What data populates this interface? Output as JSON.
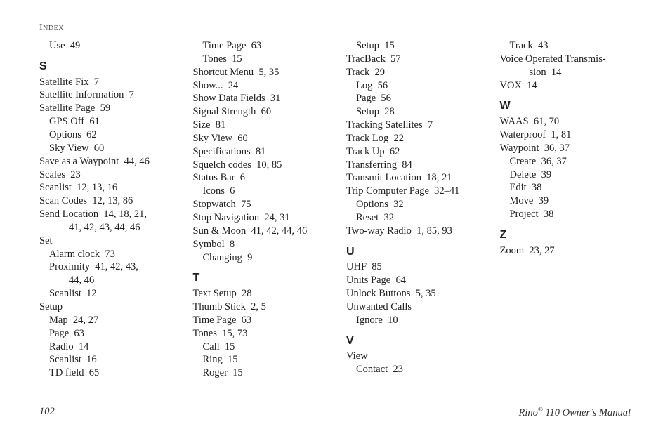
{
  "running_head": "Index",
  "footer": {
    "page_number": "102",
    "manual_title_prefix": "Rino",
    "manual_title_suffix": " 110 Owner’s Manual",
    "reg_mark": "®"
  },
  "columns": [
    [
      {
        "type": "entry",
        "level": 1,
        "text": "Use",
        "pages": "49"
      },
      {
        "type": "letter",
        "text": "S"
      },
      {
        "type": "entry",
        "level": 0,
        "text": "Satellite Fix",
        "pages": "7"
      },
      {
        "type": "entry",
        "level": 0,
        "text": "Satellite Information",
        "pages": "7"
      },
      {
        "type": "entry",
        "level": 0,
        "text": "Satellite Page",
        "pages": "59"
      },
      {
        "type": "entry",
        "level": 1,
        "text": "GPS Off",
        "pages": "61"
      },
      {
        "type": "entry",
        "level": 1,
        "text": "Options",
        "pages": "62"
      },
      {
        "type": "entry",
        "level": 1,
        "text": "Sky View",
        "pages": "60"
      },
      {
        "type": "entry",
        "level": 0,
        "text": "Save as a Waypoint",
        "pages": "44, 46"
      },
      {
        "type": "entry",
        "level": 0,
        "text": "Scales",
        "pages": "23"
      },
      {
        "type": "entry",
        "level": 0,
        "text": "Scanlist",
        "pages": "12, 13, 16"
      },
      {
        "type": "entry",
        "level": 0,
        "text": "Scan Codes",
        "pages": "12, 13, 86"
      },
      {
        "type": "entry",
        "level": 0,
        "text": "Send Location",
        "pages": "14, 18, 21,"
      },
      {
        "type": "entry",
        "level": 2,
        "text": "41, 42, 43, 44, 46",
        "pages": ""
      },
      {
        "type": "entry",
        "level": 0,
        "text": "Set",
        "pages": ""
      },
      {
        "type": "entry",
        "level": 1,
        "text": "Alarm clock",
        "pages": "73"
      },
      {
        "type": "entry",
        "level": 1,
        "text": "Proximity",
        "pages": "41, 42, 43,"
      },
      {
        "type": "entry",
        "level": 2,
        "text": "44, 46",
        "pages": ""
      },
      {
        "type": "entry",
        "level": 1,
        "text": "Scanlist",
        "pages": "12"
      },
      {
        "type": "entry",
        "level": 0,
        "text": "Setup",
        "pages": ""
      },
      {
        "type": "entry",
        "level": 1,
        "text": "Map",
        "pages": "24, 27"
      },
      {
        "type": "entry",
        "level": 1,
        "text": "Page",
        "pages": "63"
      },
      {
        "type": "entry",
        "level": 1,
        "text": "Radio",
        "pages": "14"
      },
      {
        "type": "entry",
        "level": 1,
        "text": "Scanlist",
        "pages": "16"
      },
      {
        "type": "entry",
        "level": 1,
        "text": "TD field",
        "pages": "65"
      }
    ],
    [
      {
        "type": "entry",
        "level": 1,
        "text": "Time Page",
        "pages": "63"
      },
      {
        "type": "entry",
        "level": 1,
        "text": "Tones",
        "pages": "15"
      },
      {
        "type": "entry",
        "level": 0,
        "text": "Shortcut Menu",
        "pages": "5, 35"
      },
      {
        "type": "entry",
        "level": 0,
        "text": "Show...",
        "pages": "24"
      },
      {
        "type": "entry",
        "level": 0,
        "text": "Show Data Fields",
        "pages": "31"
      },
      {
        "type": "entry",
        "level": 0,
        "text": "Signal Strength",
        "pages": "60"
      },
      {
        "type": "entry",
        "level": 0,
        "text": "Size",
        "pages": "81"
      },
      {
        "type": "entry",
        "level": 0,
        "text": "Sky View",
        "pages": "60"
      },
      {
        "type": "entry",
        "level": 0,
        "text": "Specifications",
        "pages": "81"
      },
      {
        "type": "entry",
        "level": 0,
        "text": "Squelch codes",
        "pages": "10, 85"
      },
      {
        "type": "entry",
        "level": 0,
        "text": "Status Bar",
        "pages": "6"
      },
      {
        "type": "entry",
        "level": 1,
        "text": "Icons",
        "pages": "6"
      },
      {
        "type": "entry",
        "level": 0,
        "text": "Stopwatch",
        "pages": "75"
      },
      {
        "type": "entry",
        "level": 0,
        "text": "Stop Navigation",
        "pages": "24, 31"
      },
      {
        "type": "entry",
        "level": 0,
        "text": "Sun & Moon",
        "pages": "41, 42, 44, 46"
      },
      {
        "type": "entry",
        "level": 0,
        "text": "Symbol",
        "pages": "8"
      },
      {
        "type": "entry",
        "level": 1,
        "text": "Changing",
        "pages": "9"
      },
      {
        "type": "letter",
        "text": "T"
      },
      {
        "type": "entry",
        "level": 0,
        "text": "Text Setup",
        "pages": "28"
      },
      {
        "type": "entry",
        "level": 0,
        "text": "Thumb Stick",
        "pages": "2, 5"
      },
      {
        "type": "entry",
        "level": 0,
        "text": "Time Page",
        "pages": "63"
      },
      {
        "type": "entry",
        "level": 0,
        "text": "Tones",
        "pages": "15, 73"
      },
      {
        "type": "entry",
        "level": 1,
        "text": "Call",
        "pages": "15"
      },
      {
        "type": "entry",
        "level": 1,
        "text": "Ring",
        "pages": "15"
      },
      {
        "type": "entry",
        "level": 1,
        "text": "Roger",
        "pages": "15"
      }
    ],
    [
      {
        "type": "entry",
        "level": 1,
        "text": "Setup",
        "pages": "15"
      },
      {
        "type": "entry",
        "level": 0,
        "text": "TracBack",
        "pages": "57"
      },
      {
        "type": "entry",
        "level": 0,
        "text": "Track",
        "pages": "29"
      },
      {
        "type": "entry",
        "level": 1,
        "text": "Log",
        "pages": "56"
      },
      {
        "type": "entry",
        "level": 1,
        "text": "Page",
        "pages": "56"
      },
      {
        "type": "entry",
        "level": 1,
        "text": "Setup",
        "pages": "28"
      },
      {
        "type": "entry",
        "level": 0,
        "text": "Tracking Satellites",
        "pages": "7"
      },
      {
        "type": "entry",
        "level": 0,
        "text": "Track Log",
        "pages": "22"
      },
      {
        "type": "entry",
        "level": 0,
        "text": "Track Up",
        "pages": "62"
      },
      {
        "type": "entry",
        "level": 0,
        "text": "Transferring",
        "pages": "84"
      },
      {
        "type": "entry",
        "level": 0,
        "text": "Transmit Location",
        "pages": "18, 21"
      },
      {
        "type": "entry",
        "level": 0,
        "text": "Trip Computer Page",
        "pages": "32–41"
      },
      {
        "type": "entry",
        "level": 1,
        "text": "Options",
        "pages": "32"
      },
      {
        "type": "entry",
        "level": 1,
        "text": "Reset",
        "pages": "32"
      },
      {
        "type": "entry",
        "level": 0,
        "text": "Two-way Radio",
        "pages": "1, 85, 93"
      },
      {
        "type": "letter",
        "text": "U"
      },
      {
        "type": "entry",
        "level": 0,
        "text": "UHF",
        "pages": "85"
      },
      {
        "type": "entry",
        "level": 0,
        "text": "Units Page",
        "pages": "64"
      },
      {
        "type": "entry",
        "level": 0,
        "text": "Unlock Buttons",
        "pages": "5, 35"
      },
      {
        "type": "entry",
        "level": 0,
        "text": "Unwanted Calls",
        "pages": ""
      },
      {
        "type": "entry",
        "level": 1,
        "text": "Ignore",
        "pages": "10"
      },
      {
        "type": "letter",
        "text": "V"
      },
      {
        "type": "entry",
        "level": 0,
        "text": "View",
        "pages": ""
      },
      {
        "type": "entry",
        "level": 1,
        "text": "Contact",
        "pages": "23"
      }
    ],
    [
      {
        "type": "entry",
        "level": 1,
        "text": "Track",
        "pages": "43"
      },
      {
        "type": "entry",
        "level": 0,
        "text": "Voice Operated Transmis-",
        "pages": ""
      },
      {
        "type": "entry",
        "level": 2,
        "text": "sion",
        "pages": "14"
      },
      {
        "type": "entry",
        "level": 0,
        "text": "VOX",
        "pages": "14"
      },
      {
        "type": "letter",
        "text": "W"
      },
      {
        "type": "entry",
        "level": 0,
        "text": "WAAS",
        "pages": "61, 70"
      },
      {
        "type": "entry",
        "level": 0,
        "text": "Waterproof",
        "pages": "1, 81"
      },
      {
        "type": "entry",
        "level": 0,
        "text": "Waypoint",
        "pages": "36, 37"
      },
      {
        "type": "entry",
        "level": 1,
        "text": "Create",
        "pages": "36, 37"
      },
      {
        "type": "entry",
        "level": 1,
        "text": "Delete",
        "pages": "39"
      },
      {
        "type": "entry",
        "level": 1,
        "text": "Edit",
        "pages": "38"
      },
      {
        "type": "entry",
        "level": 1,
        "text": "Move",
        "pages": "39"
      },
      {
        "type": "entry",
        "level": 1,
        "text": "Project",
        "pages": "38"
      },
      {
        "type": "letter",
        "text": "Z"
      },
      {
        "type": "entry",
        "level": 0,
        "text": "Zoom",
        "pages": "23, 27"
      }
    ]
  ]
}
